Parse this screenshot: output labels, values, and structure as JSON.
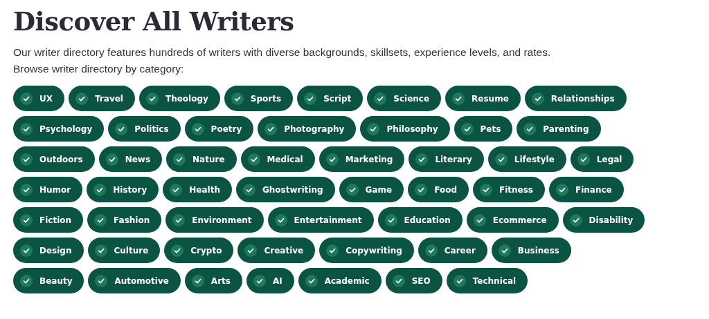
{
  "title": "Discover All Writers",
  "description": "Our writer directory features hundreds of writers with diverse backgrounds, skillsets, experience levels, and rates.",
  "prompt": "Browse writer directory by category:",
  "category_rows": [
    [
      {
        "label": "UX",
        "checked": true
      },
      {
        "label": "Travel",
        "checked": true
      },
      {
        "label": "Theology",
        "checked": true
      },
      {
        "label": "Sports",
        "checked": true
      },
      {
        "label": "Script",
        "checked": true
      },
      {
        "label": "Science",
        "checked": true
      },
      {
        "label": "Resume",
        "checked": true
      },
      {
        "label": "Relationships",
        "checked": true
      }
    ],
    [
      {
        "label": "Psychology",
        "checked": true
      },
      {
        "label": "Politics",
        "checked": true
      },
      {
        "label": "Poetry",
        "checked": true
      },
      {
        "label": "Photography",
        "checked": true
      },
      {
        "label": "Philosophy",
        "checked": true
      },
      {
        "label": "Pets",
        "checked": true
      },
      {
        "label": "Parenting",
        "checked": true
      }
    ],
    [
      {
        "label": "Outdoors",
        "checked": true
      },
      {
        "label": "News",
        "checked": true
      },
      {
        "label": "Nature",
        "checked": true
      },
      {
        "label": "Medical",
        "checked": true
      },
      {
        "label": "Marketing",
        "checked": true
      },
      {
        "label": "Literary",
        "checked": true
      },
      {
        "label": "Lifestyle",
        "checked": true
      },
      {
        "label": "Legal",
        "checked": true
      }
    ],
    [
      {
        "label": "Humor",
        "checked": true
      },
      {
        "label": "History",
        "checked": true
      },
      {
        "label": "Health",
        "checked": true
      },
      {
        "label": "Ghostwriting",
        "checked": true
      },
      {
        "label": "Game",
        "checked": true
      },
      {
        "label": "Food",
        "checked": true
      },
      {
        "label": "Fitness",
        "checked": true
      },
      {
        "label": "Finance",
        "checked": true
      }
    ],
    [
      {
        "label": "Fiction",
        "checked": true
      },
      {
        "label": "Fashion",
        "checked": true
      },
      {
        "label": "Environment",
        "checked": true
      },
      {
        "label": "Entertainment",
        "checked": true
      },
      {
        "label": "Education",
        "checked": true
      },
      {
        "label": "Ecommerce",
        "checked": true
      },
      {
        "label": "Disability",
        "checked": true
      }
    ],
    [
      {
        "label": "Design",
        "checked": true
      },
      {
        "label": "Culture",
        "checked": true
      },
      {
        "label": "Crypto",
        "checked": true
      },
      {
        "label": "Creative",
        "checked": true
      },
      {
        "label": "Copywriting",
        "checked": true
      },
      {
        "label": "Career",
        "checked": true
      },
      {
        "label": "Business",
        "checked": true
      }
    ],
    [
      {
        "label": "Beauty",
        "checked": true
      },
      {
        "label": "Automotive",
        "checked": true
      },
      {
        "label": "Arts",
        "checked": true
      },
      {
        "label": "AI",
        "checked": true
      },
      {
        "label": "Academic",
        "checked": true
      },
      {
        "label": "SEO",
        "checked": true
      },
      {
        "label": "Technical",
        "checked": true
      }
    ]
  ]
}
